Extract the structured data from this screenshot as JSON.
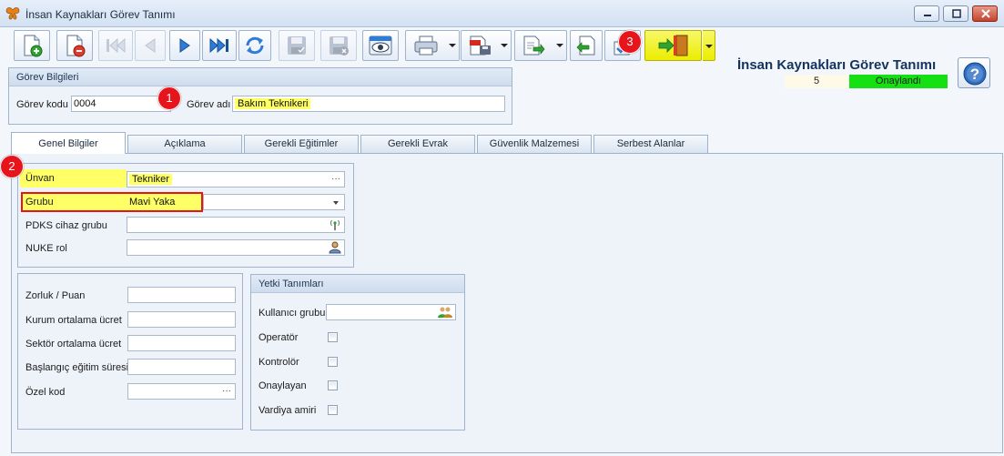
{
  "window": {
    "title": "İnsan Kaynakları Görev Tanımı"
  },
  "header": {
    "form_title": "İnsan Kaynakları Görev Tanımı",
    "record_number": "5",
    "status": "Onaylandı",
    "status_color": "#14e014"
  },
  "toolbar": {
    "buttons": [
      {
        "icon": "new-document-icon",
        "enabled": true
      },
      {
        "icon": "delete-document-icon",
        "enabled": true
      },
      {
        "icon": "first-record-icon",
        "enabled": false
      },
      {
        "icon": "previous-record-icon",
        "enabled": false
      },
      {
        "icon": "next-record-icon",
        "enabled": true
      },
      {
        "icon": "last-record-icon",
        "enabled": true
      },
      {
        "icon": "refresh-icon",
        "enabled": true
      },
      {
        "icon": "save-icon",
        "enabled": false
      },
      {
        "icon": "save-close-icon",
        "enabled": false
      },
      {
        "icon": "preview-icon",
        "enabled": true
      },
      {
        "icon": "print-icon",
        "enabled": true
      },
      {
        "icon": "pdf-export-icon",
        "enabled": true
      },
      {
        "icon": "export-icon",
        "enabled": true
      },
      {
        "icon": "import-icon",
        "enabled": true
      },
      {
        "icon": "approve-icon",
        "enabled": true
      },
      {
        "icon": "exit-door-icon",
        "enabled": true,
        "highlighted": true
      }
    ],
    "highlight_color": "#ffff00"
  },
  "gorev_bilgileri": {
    "header": "Görev Bilgileri",
    "gorev_kodu_label": "Görev kodu",
    "gorev_kodu_value": "0004",
    "gorev_adi_label": "Görev adı",
    "gorev_adi_value": "Bakım Teknikeri"
  },
  "tabs": [
    {
      "label": "Genel Bilgiler",
      "active": true
    },
    {
      "label": "Açıklama",
      "active": false
    },
    {
      "label": "Gerekli Eğitimler",
      "active": false
    },
    {
      "label": "Gerekli Evrak",
      "active": false
    },
    {
      "label": "Güvenlik Malzemesi",
      "active": false
    },
    {
      "label": "Serbest Alanlar",
      "active": false
    }
  ],
  "genel": {
    "unvan_label": "Ünvan",
    "unvan_value": "Tekniker",
    "grubu_label": "Grubu",
    "grubu_value": "Mavi Yaka",
    "pdks_label": "PDKS cihaz grubu",
    "pdks_value": "",
    "nuke_label": "NUKE rol",
    "nuke_value": ""
  },
  "numeric_group": {
    "zorluk_label": "Zorluk / Puan",
    "kurum_label": "Kurum ortalama ücret",
    "sektor_label": "Sektör ortalama ücret",
    "baslangic_label": "Başlangıç eğitim süresi",
    "ozel_kod_label": "Özel kod"
  },
  "yetki": {
    "header": "Yetki Tanımları",
    "kullanici_label": "Kullanıcı grubu",
    "operator_label": "Operatör",
    "kontrolor_label": "Kontrolör",
    "onaylayan_label": "Onaylayan",
    "vardiya_label": "Vardiya amiri",
    "operator_checked": false,
    "kontrolor_checked": false,
    "onaylayan_checked": false,
    "vardiya_checked": false
  },
  "annotations": {
    "badge_1": "1",
    "badge_2": "2",
    "badge_3": "3",
    "badge_color": "#e8141b",
    "outline_color": "#e8141b"
  }
}
